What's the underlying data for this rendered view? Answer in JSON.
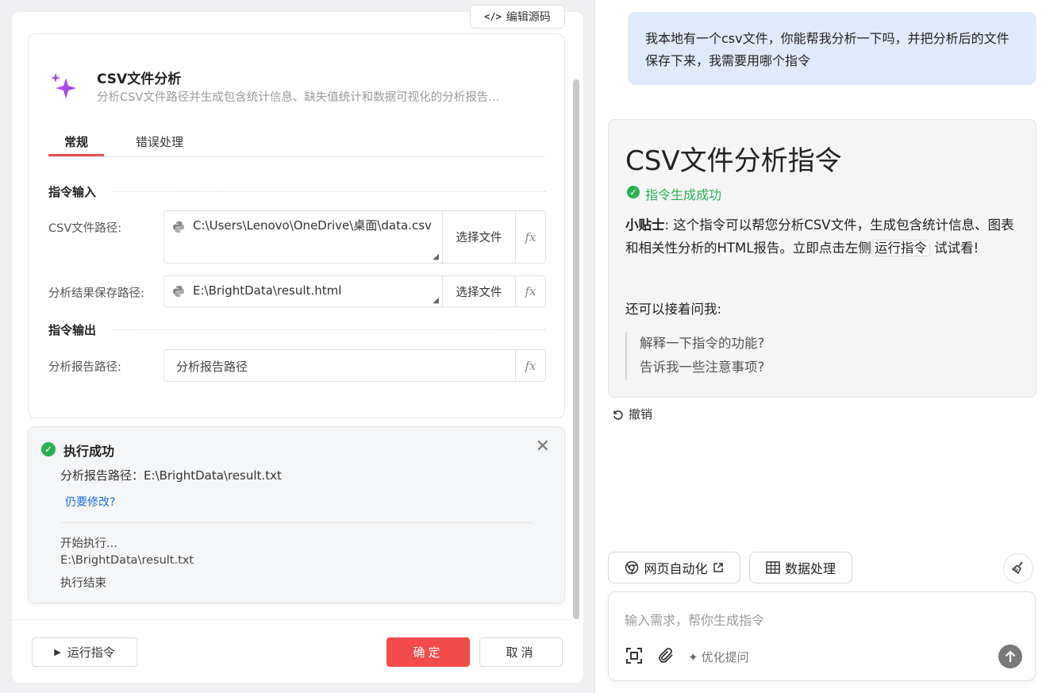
{
  "left": {
    "edit_source_label": "编辑源码",
    "card_title": "CSV文件分析",
    "card_desc": "分析CSV文件路径并生成包含统计信息、缺失值统计和数据可视化的分析报告...",
    "tabs": [
      {
        "label": "常规",
        "active": true
      },
      {
        "label": "错误处理",
        "active": false
      }
    ],
    "input_section": "指令输入",
    "output_section": "指令输出",
    "fields": {
      "csv_path": {
        "label": "CSV文件路径:",
        "value": "C:\\Users\\Lenovo\\OneDrive\\桌面\\data.csv",
        "button": "选择文件"
      },
      "save_path": {
        "label": "分析结果保存路径:",
        "value": "E:\\BrightData\\result.html",
        "button": "选择文件"
      },
      "report_path": {
        "label": "分析报告路径:",
        "value": "分析报告路径"
      }
    },
    "fx_label": "fx",
    "result": {
      "title": "执行成功",
      "path_line": "分析报告路径：E:\\BrightData\\result.txt",
      "modify_link": "仍要修改?",
      "logs": [
        "开始执行...",
        "E:\\BrightData\\result.txt",
        "执行结束"
      ]
    },
    "footer": {
      "run_label": "运行指令",
      "confirm_label": "确定",
      "cancel_label": "取消"
    }
  },
  "right": {
    "user_message": "我本地有一个csv文件，你能帮我分析一下吗，并把分析后的文件保存下来，我需要用哪个指令",
    "answer": {
      "title": "CSV文件分析指令",
      "success": "指令生成成功",
      "tip_label": "小贴士",
      "tip_text_1": ": 这个指令可以帮您分析CSV文件，生成包含统计信息、图表和相关性分析的HTML报告。立即点击左侧",
      "tip_code": "运行指令",
      "tip_text_2": " 试试看!",
      "ask_more": "还可以接着问我:",
      "suggestions": [
        "解释一下指令的功能?",
        "告诉我一些注意事项?"
      ]
    },
    "undo_label": "撤销",
    "chips": [
      {
        "label": "网页自动化",
        "icon": "chrome-icon"
      },
      {
        "label": "数据处理",
        "icon": "table-icon"
      }
    ],
    "input_placeholder": "输入需求，帮你生成指令",
    "optimize_label": "优化提问"
  },
  "colors": {
    "accent_red": "#f24b4b",
    "success_green": "#2ab14f",
    "link_blue": "#1f6fe0",
    "user_bubble": "#dfeafc"
  }
}
